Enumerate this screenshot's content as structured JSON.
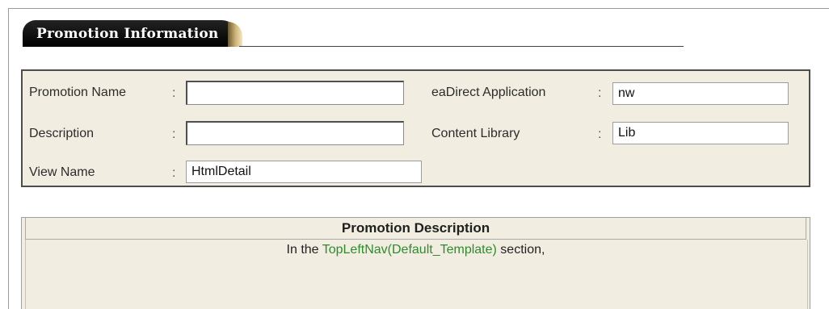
{
  "header": {
    "tab_title": "Promotion Information"
  },
  "form": {
    "promotion_name": {
      "label": "Promotion Name",
      "colon": ":",
      "value": ""
    },
    "description": {
      "label": "Description",
      "colon": ":",
      "value": ""
    },
    "view_name": {
      "label": "View Name",
      "colon": ":",
      "value": "HtmlDetail"
    },
    "eadirect_application": {
      "label": "eaDirect Application",
      "colon": ":",
      "value": "nw"
    },
    "content_library": {
      "label": "Content Library",
      "colon": ":",
      "value": "Lib"
    }
  },
  "promotion_description": {
    "header": "Promotion Description",
    "text_before": "In the ",
    "link_text": "TopLeftNav(Default_Template)",
    "text_after": " section,"
  },
  "colors": {
    "tab_bg": "#000000",
    "panel_bg": "#f1eee1",
    "link": "#2f8a2f"
  }
}
